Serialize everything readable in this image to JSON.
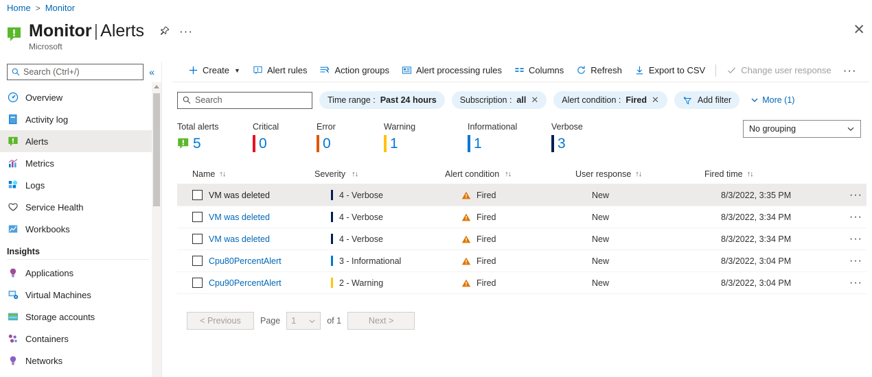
{
  "breadcrumb": {
    "home": "Home",
    "separator": ">",
    "current": "Monitor"
  },
  "header": {
    "title_main": "Monitor",
    "title_separator": "|",
    "title_sub": "Alerts",
    "subtitle": "Microsoft",
    "pin_icon": "pin-icon",
    "more_icon": "ellipsis-icon",
    "close_icon": "close-icon"
  },
  "sidebar": {
    "search_placeholder": "Search (Ctrl+/)",
    "search_icon": "search-icon",
    "collapse_icon": "double-chevron-left-icon",
    "items": [
      {
        "label": "Overview",
        "icon": "gauge-icon",
        "selected": false
      },
      {
        "label": "Activity log",
        "icon": "book-icon",
        "selected": false
      },
      {
        "label": "Alerts",
        "icon": "alert-icon",
        "selected": true
      },
      {
        "label": "Metrics",
        "icon": "bar-chart-icon",
        "selected": false
      },
      {
        "label": "Logs",
        "icon": "logs-icon",
        "selected": false
      },
      {
        "label": "Service Health",
        "icon": "heart-icon",
        "selected": false
      },
      {
        "label": "Workbooks",
        "icon": "workbook-icon",
        "selected": false
      }
    ],
    "group_title": "Insights",
    "insights": [
      {
        "label": "Applications",
        "icon": "lightbulb-icon"
      },
      {
        "label": "Virtual Machines",
        "icon": "vm-icon"
      },
      {
        "label": "Storage accounts",
        "icon": "storage-icon"
      },
      {
        "label": "Containers",
        "icon": "containers-icon"
      },
      {
        "label": "Networks",
        "icon": "network-icon"
      }
    ]
  },
  "toolbar": {
    "create_label": "Create",
    "alert_rules_label": "Alert rules",
    "action_groups_label": "Action groups",
    "alert_processing_rules_label": "Alert processing rules",
    "columns_label": "Columns",
    "refresh_label": "Refresh",
    "export_csv_label": "Export to CSV",
    "change_user_response_label": "Change user response",
    "overflow_label": "···"
  },
  "filters": {
    "search_placeholder": "Search",
    "search_icon": "search-icon",
    "time_range": {
      "key": "Time range :",
      "value": "Past 24 hours"
    },
    "subscription": {
      "key": "Subscription :",
      "value": "all"
    },
    "alert_condition": {
      "key": "Alert condition :",
      "value": "Fired"
    },
    "add_filter_label": "Add filter",
    "more_label": "More (1)"
  },
  "summary": {
    "metrics": [
      {
        "label": "Total alerts",
        "value": "5",
        "color": "#5cb82b",
        "is_total": true
      },
      {
        "label": "Critical",
        "value": "0",
        "color": "#e81123"
      },
      {
        "label": "Error",
        "value": "0",
        "color": "#dd5900"
      },
      {
        "label": "Warning",
        "value": "1",
        "color": "#ffc20e"
      },
      {
        "label": "Informational",
        "value": "1",
        "color": "#0078d4"
      },
      {
        "label": "Verbose",
        "value": "3",
        "color": "#002050"
      }
    ],
    "grouping_value": "No grouping"
  },
  "table": {
    "columns": [
      {
        "label": "Name",
        "sort_icon": "sort-icon"
      },
      {
        "label": "Severity",
        "sort_icon": "sort-icon"
      },
      {
        "label": "Alert condition",
        "sort_icon": "sort-icon"
      },
      {
        "label": "User response",
        "sort_icon": "sort-icon"
      },
      {
        "label": "Fired time",
        "sort_icon": "sort-icon"
      }
    ],
    "rows": [
      {
        "name": "VM was deleted",
        "severity": "4 - Verbose",
        "severity_color": "#002050",
        "condition": "Fired",
        "response": "New",
        "fired_time": "8/3/2022, 3:35 PM",
        "hovered": true
      },
      {
        "name": "VM was deleted",
        "severity": "4 - Verbose",
        "severity_color": "#002050",
        "condition": "Fired",
        "response": "New",
        "fired_time": "8/3/2022, 3:34 PM",
        "hovered": false
      },
      {
        "name": "VM was deleted",
        "severity": "4 - Verbose",
        "severity_color": "#002050",
        "condition": "Fired",
        "response": "New",
        "fired_time": "8/3/2022, 3:34 PM",
        "hovered": false
      },
      {
        "name": "Cpu80PercentAlert",
        "severity": "3 - Informational",
        "severity_color": "#0078d4",
        "condition": "Fired",
        "response": "New",
        "fired_time": "8/3/2022, 3:04 PM",
        "hovered": false
      },
      {
        "name": "Cpu90PercentAlert",
        "severity": "2 - Warning",
        "severity_color": "#ffc20e",
        "condition": "Fired",
        "response": "New",
        "fired_time": "8/3/2022, 3:04 PM",
        "hovered": false
      }
    ],
    "row_menu_icon": "ellipsis-icon",
    "condition_icon": "warning-triangle-icon"
  },
  "pager": {
    "previous_label": "< Previous",
    "page_label": "Page",
    "page_value": "1",
    "of_label": "of 1",
    "next_label": "Next >"
  },
  "colors": {
    "link": "#0067b8",
    "accent": "#0078d4",
    "pill_bg": "#e5f2fb",
    "row_hover": "#edebe9"
  }
}
